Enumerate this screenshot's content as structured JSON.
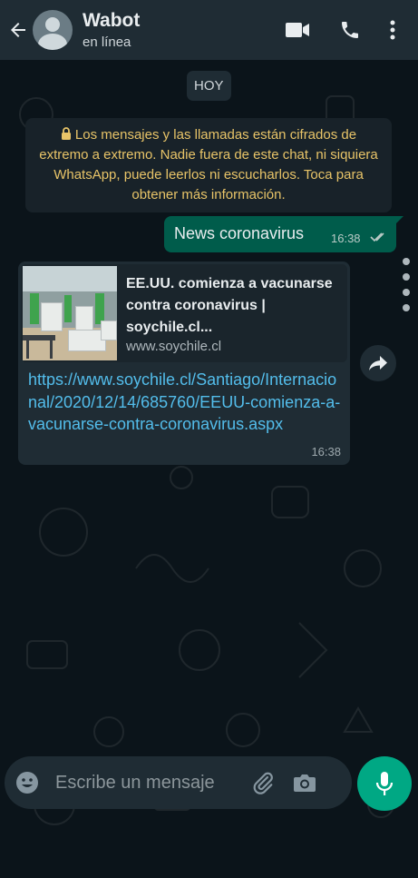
{
  "header": {
    "contact_name": "Wabot",
    "status": "en línea"
  },
  "chat": {
    "date_label": "HOY",
    "encryption_notice": "Los mensajes y las llamadas están cifrados de extremo a extremo. Nadie fuera de este chat, ni siquiera WhatsApp, puede leerlos ni escucharlos. Toca para obtener más información.",
    "messages": [
      {
        "direction": "outgoing",
        "text": "News coronavirus",
        "time": "16:38",
        "status_icon": "double-check-icon"
      },
      {
        "direction": "incoming",
        "preview_title": "EE.UU. comienza a vacunarse contra coronavirus | soychile.cl...",
        "preview_domain": "www.soychile.cl",
        "link": "https://www.soychile.cl/Santiago/Internacional/2020/12/14/685760/EEUU-comienza-a-vacunarse-contra-coronavirus.aspx",
        "time": "16:38"
      }
    ]
  },
  "composer": {
    "placeholder": "Escribe un mensaje"
  },
  "colors": {
    "header_bg": "#1f2c34",
    "chat_bg": "#0b141a",
    "outgoing_bubble": "#005c4b",
    "incoming_bubble": "#1f2c34",
    "link": "#53bdeb",
    "notice_text": "#e8c468",
    "accent": "#00a884"
  }
}
